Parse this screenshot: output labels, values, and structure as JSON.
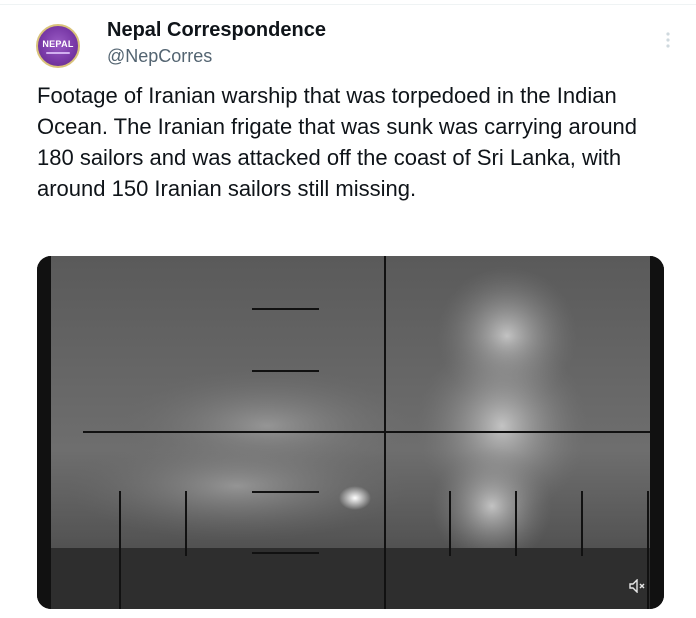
{
  "author": {
    "avatar_text": "NEPAL",
    "display_name": "Nepal Correspondence",
    "handle": "@NepCorres"
  },
  "menu": {
    "more_icon": "more-vertical-icon"
  },
  "tweet": {
    "text": "Footage of Iranian warship that was torpedoed in the Indian Ocean. The Iranian frigate that was sunk was carrying around 180 sailors and was attacked off the coast of Sri Lanka, with around 150 Iranian sailors still missing."
  },
  "media": {
    "type": "video",
    "volume_icon": "speaker-muted-icon"
  }
}
